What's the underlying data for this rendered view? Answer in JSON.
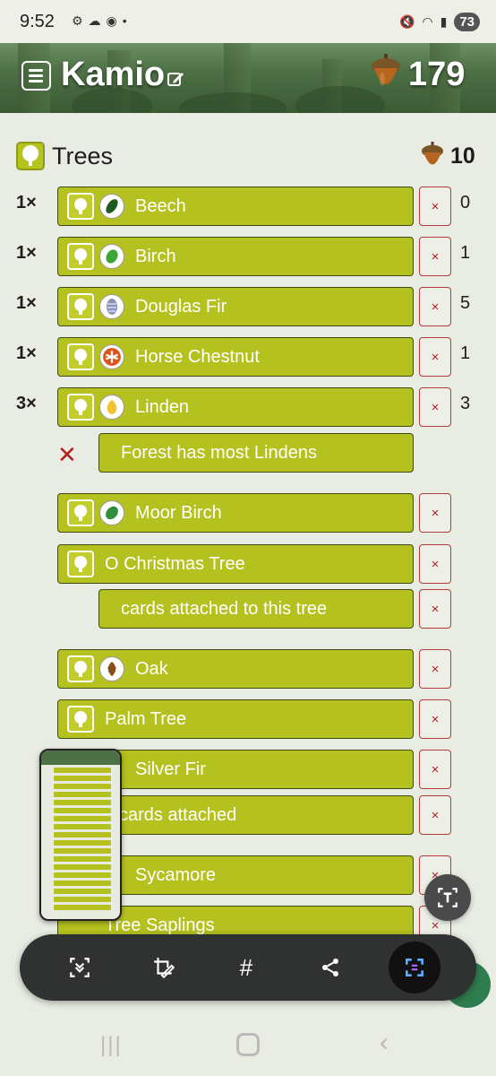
{
  "status_bar": {
    "time": "9:52",
    "battery": "73"
  },
  "header": {
    "title": "Kamio",
    "score": "179"
  },
  "section": {
    "title": "Trees",
    "count": "10"
  },
  "rows": [
    {
      "qty": "1×",
      "label": "Beech",
      "species": "beech-leaf-icon",
      "number": "0"
    },
    {
      "qty": "1×",
      "label": "Birch",
      "species": "birch-leaf-icon",
      "number": "1"
    },
    {
      "qty": "1×",
      "label": "Douglas Fir",
      "species": "fir-cone-icon",
      "number": "5"
    },
    {
      "qty": "1×",
      "label": "Horse Chestnut",
      "species": "chestnut-leaf-icon",
      "number": "1"
    },
    {
      "qty": "3×",
      "label": "Linden",
      "species": "linden-leaf-icon",
      "number": "3"
    },
    {
      "label": "Forest has most Lindens"
    },
    {
      "label": "Moor Birch",
      "species": "moor-birch-leaf-icon"
    },
    {
      "label": "O Christmas Tree"
    },
    {
      "label": "cards attached to this tree"
    },
    {
      "label": "Oak",
      "species": "oak-leaf-icon"
    },
    {
      "label": "Palm Tree"
    },
    {
      "label": "Silver Fir"
    },
    {
      "label": "cards attached"
    },
    {
      "label": "Sycamore"
    },
    {
      "label": "Tree Saplings"
    }
  ],
  "remove_label": "×",
  "fail_mark": "✕",
  "colors": {
    "card": "#b5c11e",
    "card_border": "#3f4a14",
    "remove_border": "#b23b3b",
    "background": "#e8ece2"
  },
  "toolbar": {
    "hashtag": "#"
  }
}
